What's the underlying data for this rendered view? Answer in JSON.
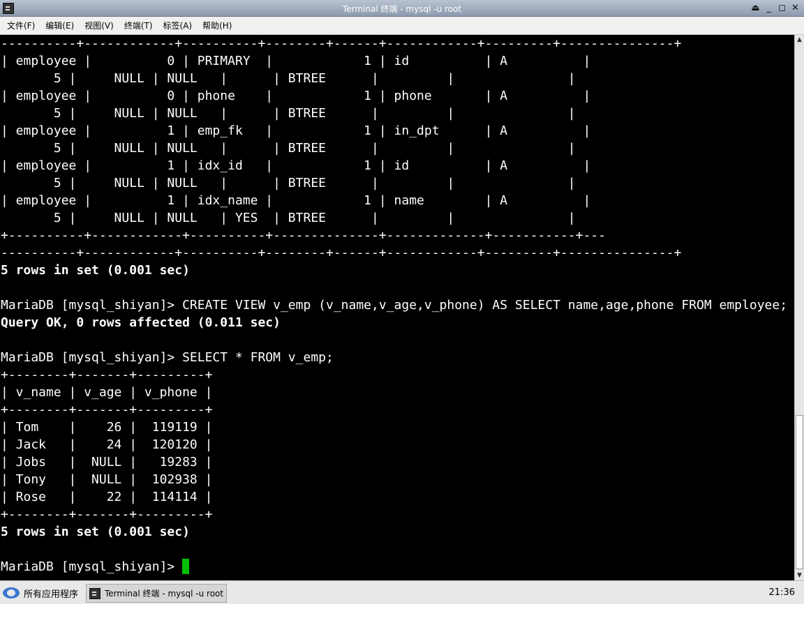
{
  "window": {
    "title": "Terminal 终端 - mysql -u root",
    "controls": [
      "⏏",
      "_",
      "◻",
      "✕"
    ],
    "icon": "terminal-icon"
  },
  "menu": [
    "文件(F)",
    "编辑(E)",
    "视图(V)",
    "终端(T)",
    "标签(A)",
    "帮助(H)"
  ],
  "terminal": {
    "lines": [
      {
        "text": "----------+------------+----------+--------+------+------------+---------+---------------+",
        "bold": false
      },
      {
        "text": "| employee |          0 | PRIMARY  |            1 | id          | A          |",
        "bold": false
      },
      {
        "text": "       5 |     NULL | NULL   |      | BTREE      |         |               |",
        "bold": false
      },
      {
        "text": "| employee |          0 | phone    |            1 | phone       | A          |",
        "bold": false
      },
      {
        "text": "       5 |     NULL | NULL   |      | BTREE      |         |               |",
        "bold": false
      },
      {
        "text": "| employee |          1 | emp_fk   |            1 | in_dpt      | A          |",
        "bold": false
      },
      {
        "text": "       5 |     NULL | NULL   |      | BTREE      |         |               |",
        "bold": false
      },
      {
        "text": "| employee |          1 | idx_id   |            1 | id          | A          |",
        "bold": false
      },
      {
        "text": "       5 |     NULL | NULL   |      | BTREE      |         |               |",
        "bold": false
      },
      {
        "text": "| employee |          1 | idx_name |            1 | name        | A          |",
        "bold": false
      },
      {
        "text": "       5 |     NULL | NULL   | YES  | BTREE      |         |               |",
        "bold": false
      },
      {
        "text": "+----------+------------+----------+--------------+-------------+-----------+---",
        "bold": false
      },
      {
        "text": "----------+------------+----------+--------+------+------------+---------+---------------+",
        "bold": false
      },
      {
        "text": "5 rows in set (0.001 sec)",
        "bold": true
      },
      {
        "text": "",
        "bold": false
      },
      {
        "text": "MariaDB [mysql_shiyan]> CREATE VIEW v_emp (v_name,v_age,v_phone) AS SELECT name,age,phone FROM employee;",
        "bold": false
      },
      {
        "text": "Query OK, 0 rows affected (0.011 sec)",
        "bold": true
      },
      {
        "text": "",
        "bold": false
      },
      {
        "text": "MariaDB [mysql_shiyan]> SELECT * FROM v_emp;",
        "bold": false
      },
      {
        "text": "+--------+-------+---------+",
        "bold": false
      },
      {
        "text": "| v_name | v_age | v_phone |",
        "bold": false
      },
      {
        "text": "+--------+-------+---------+",
        "bold": false
      },
      {
        "text": "| Tom    |    26 |  119119 |",
        "bold": false
      },
      {
        "text": "| Jack   |    24 |  120120 |",
        "bold": false
      },
      {
        "text": "| Jobs   |  NULL |   19283 |",
        "bold": false
      },
      {
        "text": "| Tony   |  NULL |  102938 |",
        "bold": false
      },
      {
        "text": "| Rose   |    22 |  114114 |",
        "bold": false
      },
      {
        "text": "+--------+-------+---------+",
        "bold": false
      },
      {
        "text": "5 rows in set (0.001 sec)",
        "bold": true
      },
      {
        "text": "",
        "bold": false
      },
      {
        "text": "MariaDB [mysql_shiyan]> ",
        "bold": false,
        "cursor": true
      }
    ],
    "cursor_color": "#00c000"
  },
  "taskbar": {
    "start_label": "所有应用程序",
    "task_label": "Terminal 终端 - mysql -u root",
    "clock": "21:36"
  }
}
